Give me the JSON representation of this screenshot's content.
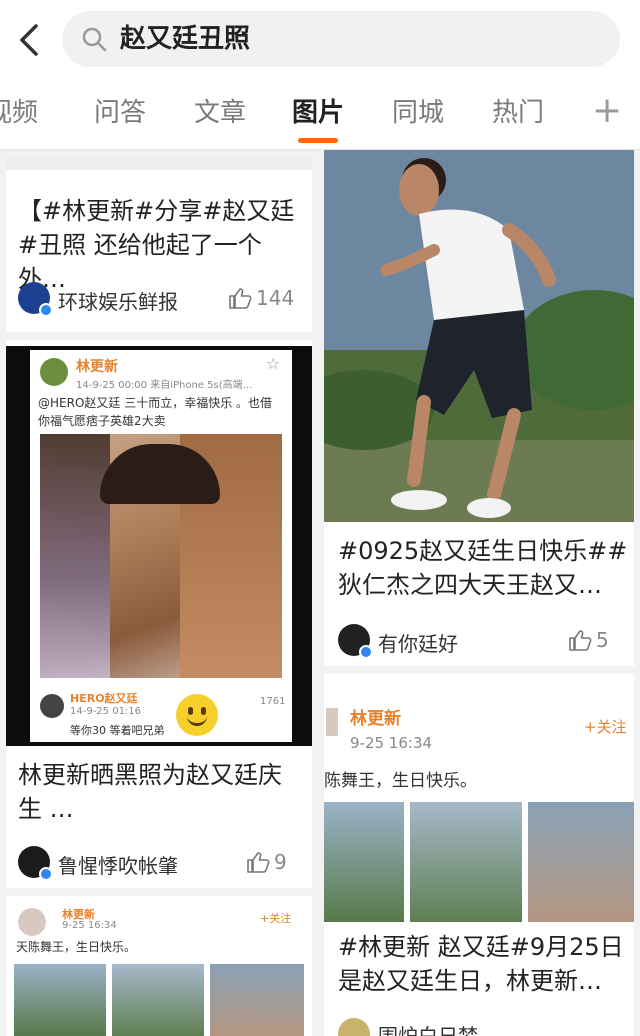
{
  "search": {
    "query": "赵又廷丑照"
  },
  "tabs": [
    {
      "label": "视频"
    },
    {
      "label": "问答"
    },
    {
      "label": "文章"
    },
    {
      "label": "图片"
    },
    {
      "label": "同城"
    },
    {
      "label": "热门"
    }
  ],
  "tabs_plus": "+",
  "colors": {
    "accent": "#ff6a00",
    "verified": "#2f86f6"
  },
  "left_cards": [
    {
      "title": "【#林更新#分享#赵又廷#丑照 还给他起了一个外…",
      "author": "环球娱乐鲜报",
      "likes": "144"
    },
    {
      "title": "林更新晒黑照为赵又廷庆生 …",
      "author": "鲁惺悸吹帐肇",
      "likes": "9",
      "post": {
        "user": "林更新",
        "time": "14-9-25 00:00  来自iPhone 5s(高端…",
        "text": "@HERO赵又廷 三十而立，幸福快乐 。也借你福气愿痞子英雄2大卖",
        "reply_user": "HERO赵又廷",
        "reply_time": "14-9-25 01:16",
        "reply_text": "等你30 等着吧兄弟",
        "reply_likes": "1761"
      }
    },
    {
      "post": {
        "user": "林更新",
        "time": "9-25 16:34",
        "text": "天陈舞王，生日快乐。",
        "follow": "+关注"
      }
    }
  ],
  "right_cards": [
    {
      "title": "#0925赵又廷生日快乐##狄仁杰之四大天王赵又…",
      "author": "有你廷好",
      "likes": "5"
    },
    {
      "title": "#林更新 赵又廷#9月25日是赵又廷生日，林更新…",
      "author": "围炉白日梦",
      "post": {
        "user": "林更新",
        "time": "9-25 16:34",
        "text": "陈舞王，生日快乐。",
        "follow": "+关注"
      }
    }
  ]
}
